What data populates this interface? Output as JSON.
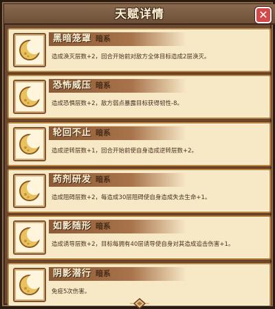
{
  "header": {
    "title": "天赋详情"
  },
  "close_icon": "close-icon",
  "talents": [
    {
      "name": "黑暗笼罩",
      "type": "暗系",
      "desc": "造成涣灭层数+2，回合开始前对敌方全体目标造成2层涣灭。",
      "icon": "moon-icon"
    },
    {
      "name": "恐怖威压",
      "type": "暗系",
      "desc": "造成恐惧层数+2，敌方弱点暴露目标获得韧性-8。",
      "icon": "moon-icon"
    },
    {
      "name": "轮回不止",
      "type": "暗系",
      "desc": "造成逆转层数+1，回合开始前使自身造成逆转层数+2。",
      "icon": "moon-icon"
    },
    {
      "name": "药剂研发",
      "type": "暗系",
      "desc": "造成阻碍层数+2，每造成30层阻碍使自身造成失去生命+1。",
      "icon": "moon-icon"
    },
    {
      "name": "如影随形",
      "type": "暗系",
      "desc": "造成诱导层数+2，目标每拥有40层诱导使自身对其造成追击伤害+1。",
      "icon": "moon-icon"
    },
    {
      "name": "阴影潜行",
      "type": "暗系",
      "desc": "免疫5次伤害。",
      "icon": "moon-icon"
    }
  ]
}
